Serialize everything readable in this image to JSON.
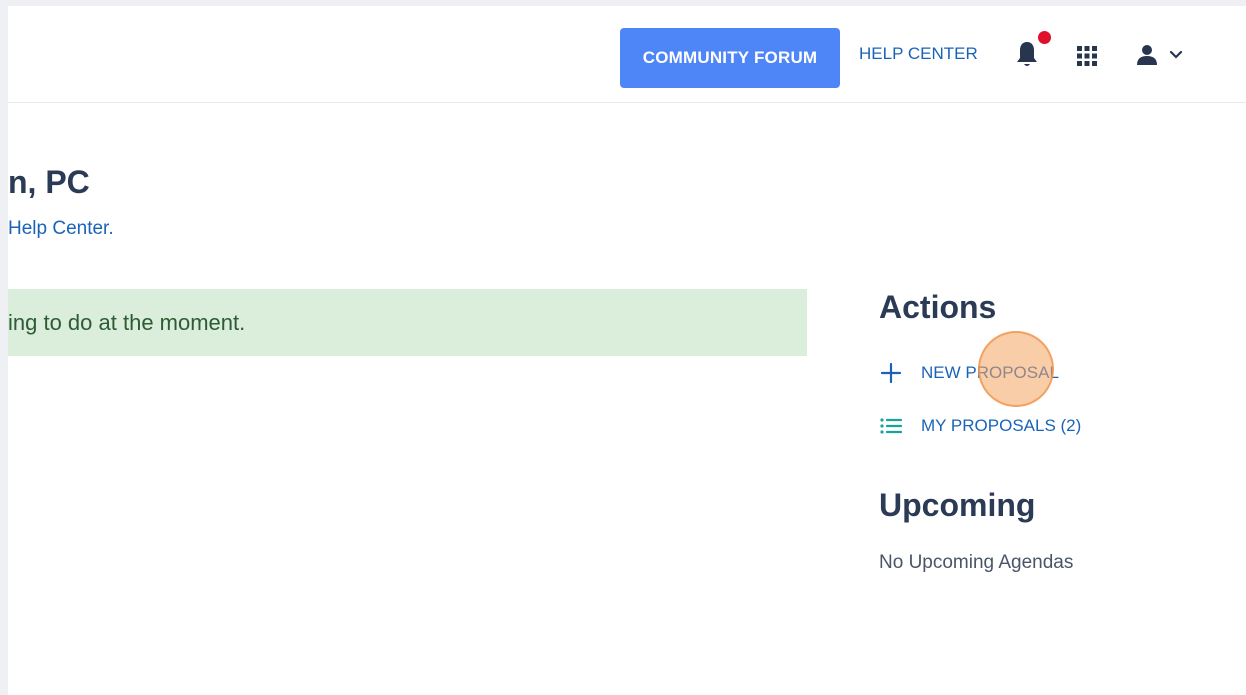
{
  "header": {
    "forum_button": "COMMUNITY FORUM",
    "help_link": "HELP CENTER",
    "icons": [
      "bell-icon",
      "apps-grid-icon",
      "user-icon",
      "chevron-down-icon"
    ],
    "notification_dot_color": "#e0102a",
    "button_color": "#4f86f7"
  },
  "main": {
    "title": "n, PC",
    "subtitle": "Help Center.",
    "notice": "ing to do at the moment.",
    "notice_bg": "#dbeddb"
  },
  "sidebar": {
    "actions_heading": "Actions",
    "actions": [
      {
        "label": "NEW PROPOSAL",
        "icon": "plus-icon"
      },
      {
        "label": "MY PROPOSALS (2)",
        "icon": "list-icon"
      }
    ],
    "upcoming_heading": "Upcoming",
    "upcoming_empty": "No Upcoming Agendas"
  }
}
